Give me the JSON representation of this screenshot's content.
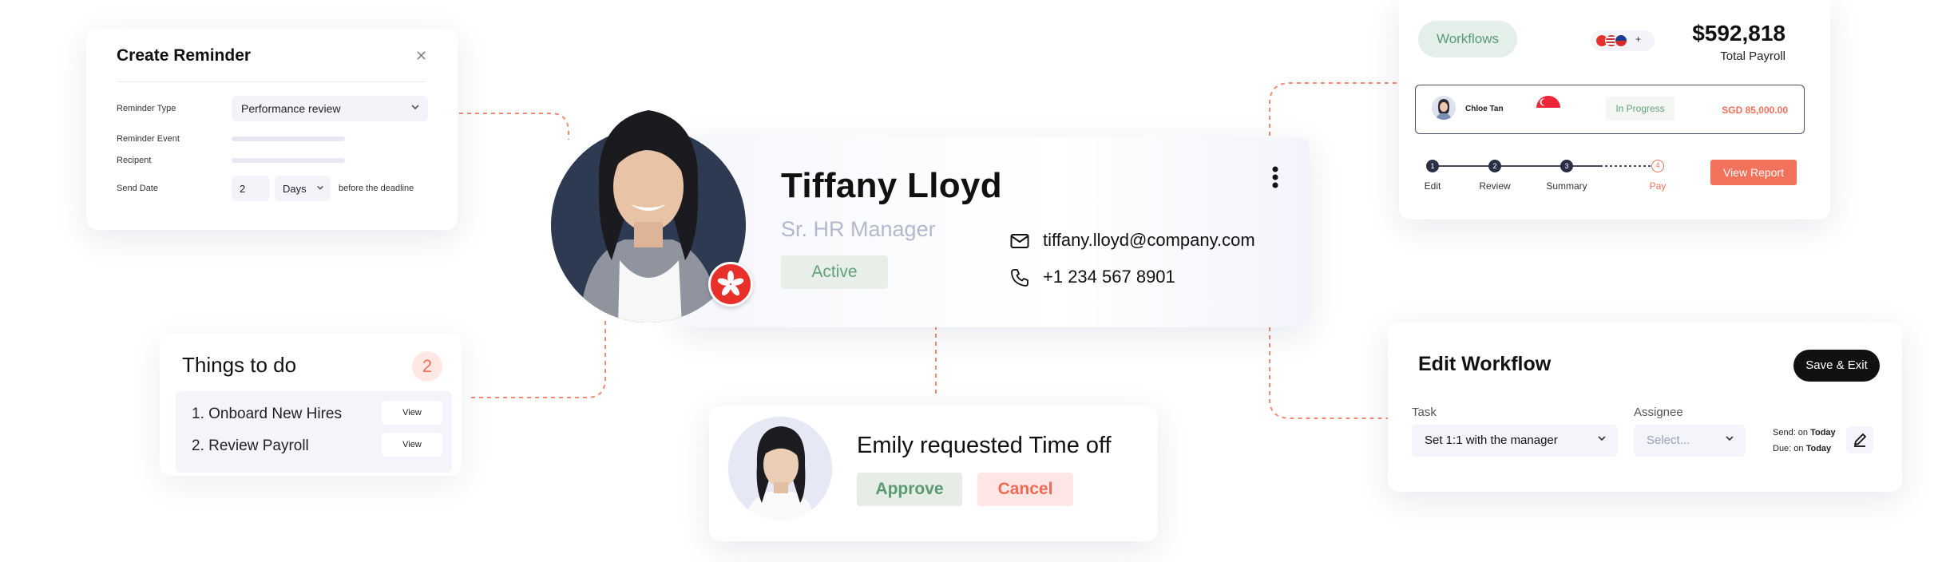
{
  "reminder": {
    "title": "Create Reminder",
    "close_icon": "close-icon",
    "type_label": "Reminder Type",
    "type_value": "Performance review",
    "event_label": "Reminder Event",
    "recipient_label": "Recipent",
    "send_date_label": "Send Date",
    "send_number": "2",
    "send_unit": "Days",
    "send_suffix": "before the deadline"
  },
  "todo": {
    "title": "Things to do",
    "count": "2",
    "items": [
      {
        "label": "1. Onboard New Hires",
        "button": "View"
      },
      {
        "label": "2. Review Payroll",
        "button": "View"
      }
    ]
  },
  "profile": {
    "name": "Tiffany Lloyd",
    "role": "Sr. HR Manager",
    "status": "Active",
    "email": "tiffany.lloyd@company.com",
    "phone": "+1 234 567 8901",
    "flag_icon": "hong-kong-flag-icon",
    "menu_icon": "kebab-menu-icon"
  },
  "timeoff": {
    "message": "Emily requested Time off",
    "approve": "Approve",
    "cancel": "Cancel"
  },
  "payroll": {
    "workflows": "Workflows",
    "flags_more": "+",
    "amount": "$592,818",
    "amount_label": "Total Payroll",
    "employee": "Chloe Tan",
    "status": "In Progress",
    "salary": "SGD 85,000.00",
    "steps": [
      "Edit",
      "Review",
      "Summary",
      "Pay"
    ],
    "step_numbers": [
      "1",
      "2",
      "3",
      "4"
    ],
    "view_report": "View Report"
  },
  "edit_workflow": {
    "title": "Edit Workflow",
    "save": "Save & Exit",
    "task_header": "Task",
    "assignee_header": "Assignee",
    "task_value": "Set 1:1 with the manager",
    "assignee_placeholder": "Select...",
    "send_label": "Send: on ",
    "send_value": "Today",
    "due_label": "Due: on ",
    "due_value": "Today"
  },
  "colors": {
    "accent": "#f2725b",
    "success": "#5fa177",
    "dark": "#111111"
  }
}
